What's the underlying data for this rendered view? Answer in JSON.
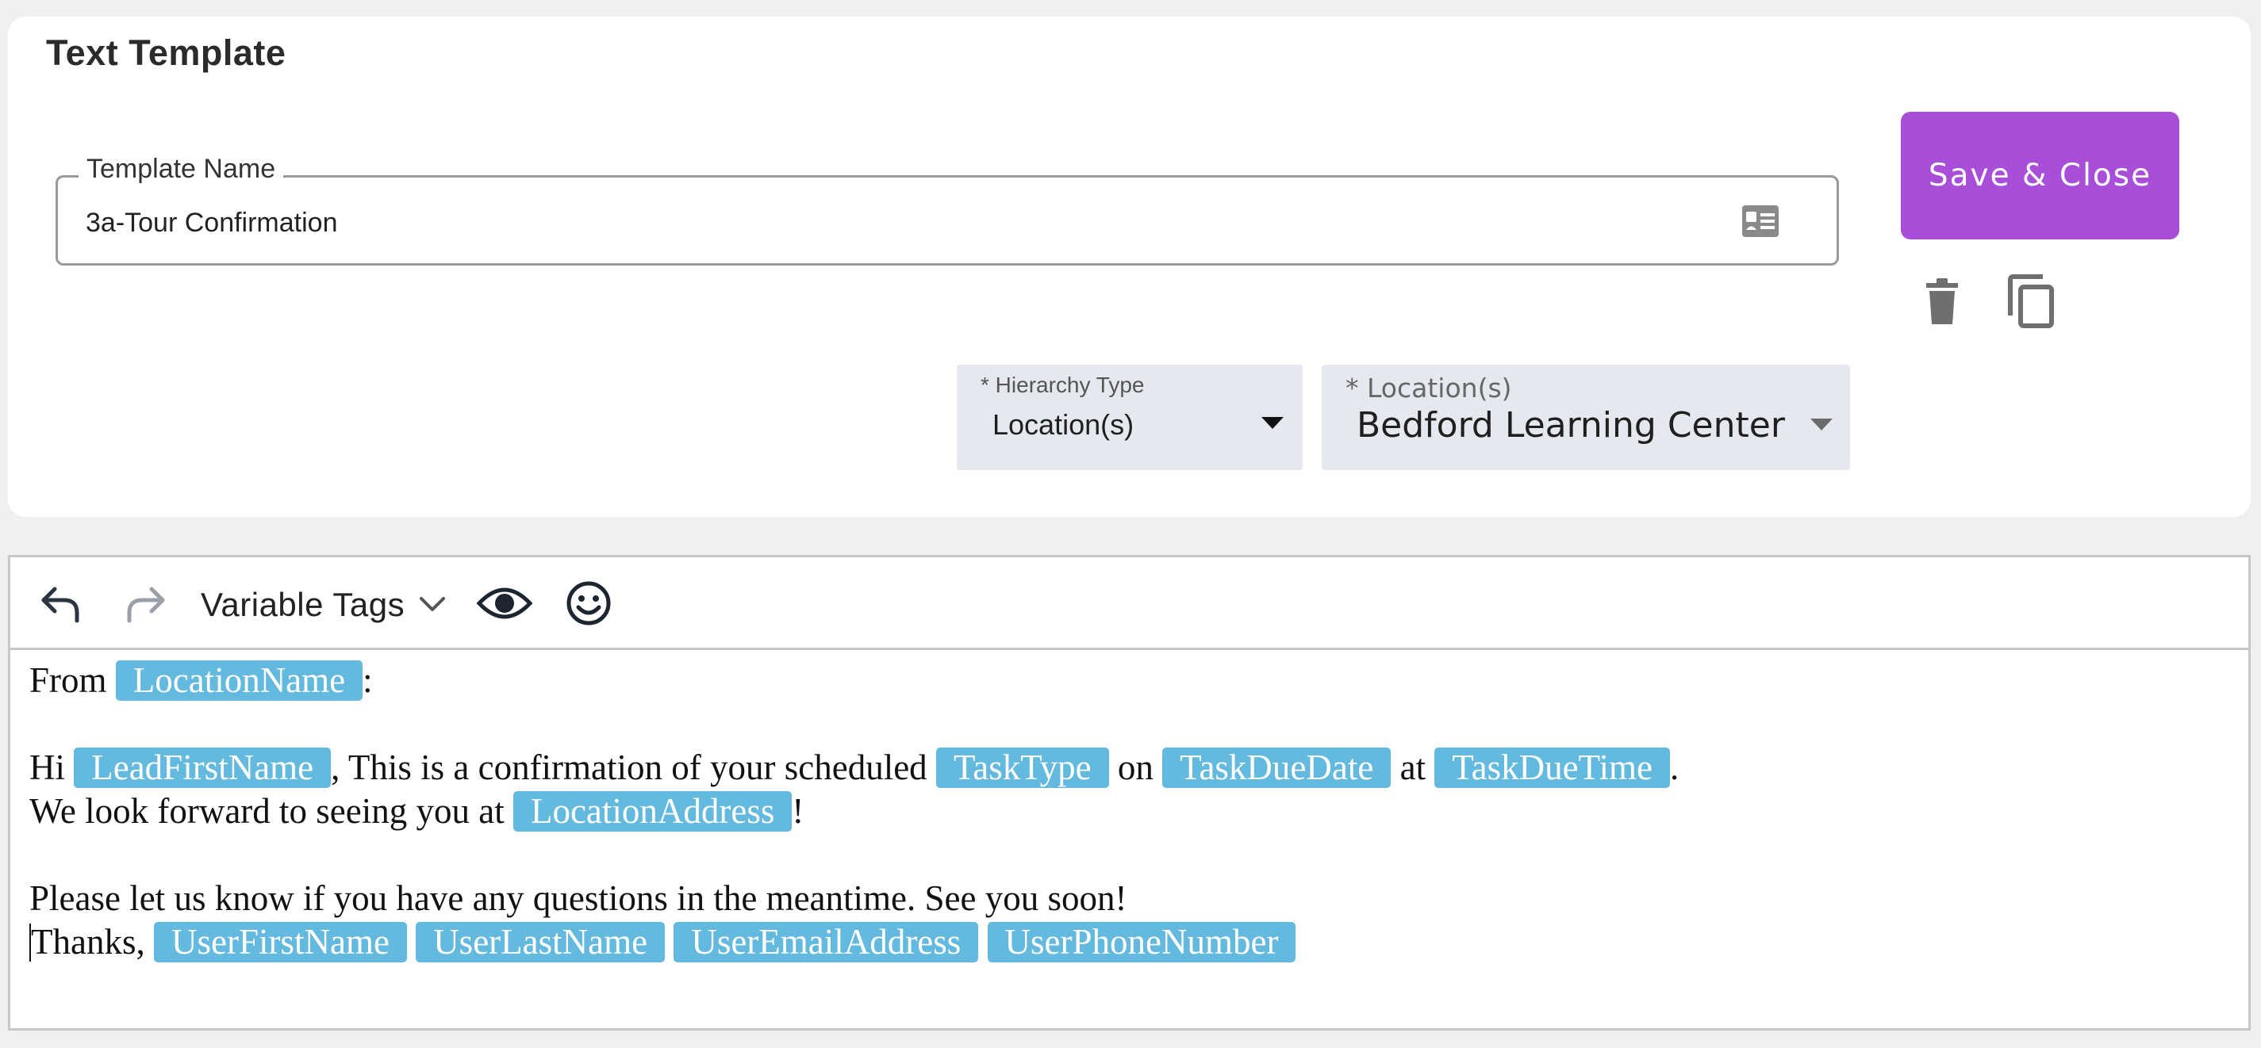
{
  "card": {
    "title": "Text Template",
    "template_name_label": "Template Name",
    "template_name_value": "3a-Tour Confirmation",
    "save_button_label": "Save & Close",
    "hierarchy_type": {
      "label": "* Hierarchy Type",
      "value": "Location(s)"
    },
    "locations": {
      "label": "* Location(s)",
      "value": "Bedford Learning Center"
    }
  },
  "toolbar": {
    "undo_icon": "undo-icon",
    "redo_icon": "redo-icon",
    "variable_tags_label": "Variable Tags",
    "preview_icon": "eye-icon",
    "emoji_icon": "smiley-icon"
  },
  "content": {
    "line1": {
      "text1": "From",
      "tag1": "LocationName",
      "text2": ":"
    },
    "line3": {
      "text1": "Hi",
      "tag1": "LeadFirstName",
      "text2": ", This is a confirmation of your scheduled",
      "tag2": "TaskType",
      "text3": "on",
      "tag3": "TaskDueDate",
      "text4": "at",
      "tag4": "TaskDueTime",
      "text5": "."
    },
    "line4": {
      "text1": "We look forward to seeing you at",
      "tag1": "LocationAddress",
      "text2": "!"
    },
    "line6": {
      "text1": "Please let us know if you have any questions in the meantime. See you soon!"
    },
    "line7": {
      "text1": "Thanks,",
      "tag1": "UserFirstName",
      "tag2": "UserLastName",
      "tag3": "UserEmailAddress",
      "tag4": "UserPhoneNumber"
    }
  },
  "colors": {
    "accent": "#a94ed9",
    "tag_background": "#63b9de",
    "select_background": "#e5e8ef",
    "page_background": "#eff0f2"
  }
}
